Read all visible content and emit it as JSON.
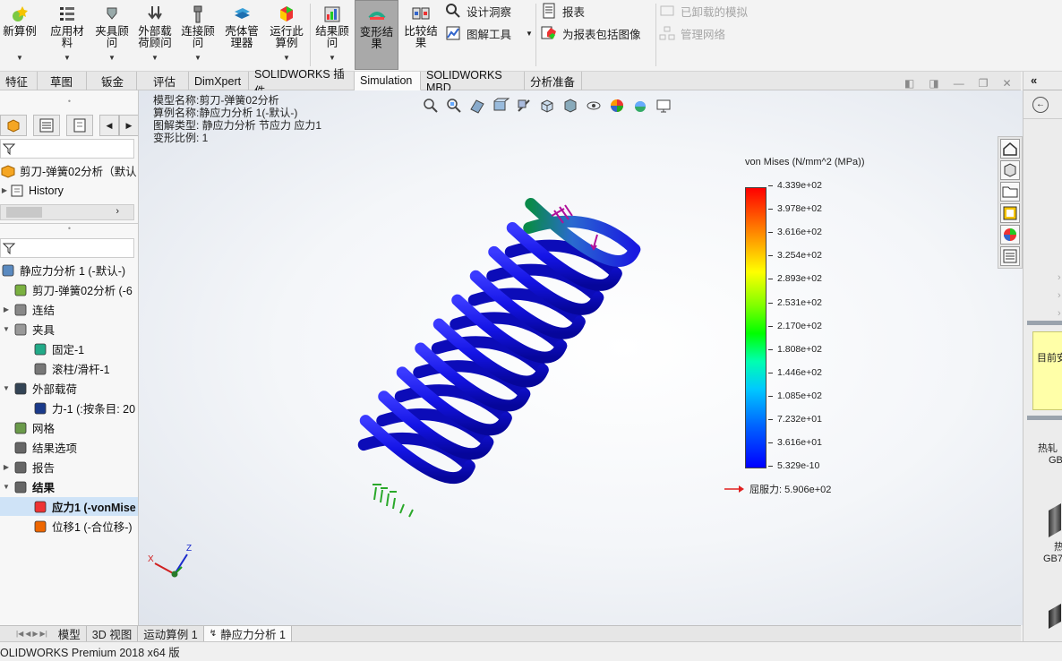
{
  "ribbon": {
    "buttons": [
      {
        "label": "新算例",
        "icon": "new-study-icon"
      },
      {
        "label": "应用材\n料",
        "icon": "apply-material-icon"
      },
      {
        "label": "夹具顾\n问",
        "icon": "fixture-advisor-icon"
      },
      {
        "label": "外部载\n荷顾问",
        "icon": "external-load-advisor-icon"
      },
      {
        "label": "连接顾\n问",
        "icon": "connection-advisor-icon"
      },
      {
        "label": "壳体管\n理器",
        "icon": "shell-manager-icon"
      },
      {
        "label": "运行此\n算例",
        "icon": "run-study-icon"
      },
      {
        "label": "结果顾\n问",
        "icon": "results-advisor-icon"
      },
      {
        "label": "变形结\n果",
        "icon": "deformed-result-icon"
      },
      {
        "label": "比较结\n果",
        "icon": "compare-results-icon"
      }
    ],
    "small": {
      "design_insight": "设计洞察",
      "plot_tools": "图解工具",
      "report": "报表",
      "include_image": "为报表包括图像",
      "unloaded_sims": "已卸载的模拟",
      "manage_network": "管理网络"
    }
  },
  "tabs": [
    "特征",
    "草图",
    "钣金",
    "评估",
    "DimXpert",
    "SOLIDWORKS 插件",
    "Simulation",
    "SOLIDWORKS MBD",
    "分析准备"
  ],
  "active_tab": "Simulation",
  "left": {
    "top_tree": {
      "part": "剪刀-弹簧02分析（默认",
      "history": "History"
    },
    "study_tree": [
      {
        "label": "静应力分析 1 (-默认-)",
        "icon": "static-study-icon",
        "indent": 0
      },
      {
        "label": "剪刀-弹簧02分析 (-6",
        "icon": "part-icon",
        "indent": 1
      },
      {
        "label": "连结",
        "icon": "connections-icon",
        "indent": 1
      },
      {
        "label": "夹具",
        "icon": "fixtures-icon",
        "indent": 1
      },
      {
        "label": "固定-1",
        "icon": "fixed-icon",
        "indent": 2
      },
      {
        "label": "滚柱/滑杆-1",
        "icon": "roller-slider-icon",
        "indent": 2
      },
      {
        "label": "外部载荷",
        "icon": "external-loads-icon",
        "indent": 1
      },
      {
        "label": "力-1 (:按条目: 20",
        "icon": "force-icon",
        "indent": 2
      },
      {
        "label": "网格",
        "icon": "mesh-icon",
        "indent": 1
      },
      {
        "label": "结果选项",
        "icon": "result-options-icon",
        "indent": 1
      },
      {
        "label": "报告",
        "icon": "report-icon",
        "indent": 1
      },
      {
        "label": "结果",
        "icon": "results-icon",
        "indent": 1
      },
      {
        "label": "应力1 (-vonMise",
        "icon": "stress-plot-icon",
        "indent": 2
      },
      {
        "label": "位移1 (-合位移-)",
        "icon": "displacement-plot-icon",
        "indent": 2
      }
    ]
  },
  "viewport": {
    "info": [
      "模型名称:剪刀-弹簧02分析",
      "算例名称:静应力分析 1(-默认-)",
      "图解类型: 静应力分析 节应力 应力1",
      "变形比例: 1"
    ],
    "legend": {
      "title": "von Mises (N/mm^2 (MPa))",
      "ticks": [
        "4.339e+02",
        "3.978e+02",
        "3.616e+02",
        "3.254e+02",
        "2.893e+02",
        "2.531e+02",
        "2.170e+02",
        "1.808e+02",
        "1.446e+02",
        "1.085e+02",
        "7.232e+01",
        "3.616e+01",
        "5.329e-10"
      ],
      "yield_label": "屈服力: 5.906e+02"
    },
    "axes": {
      "x": "X",
      "y": "Y",
      "z": "Z"
    }
  },
  "right_panel": {
    "label1": "目前安",
    "label2": "热轧",
    "label3": "GB",
    "label4": "热",
    "label5": "GB7"
  },
  "bottom_tabs": [
    "模型",
    "3D 视图",
    "运动算例 1",
    "静应力分析 1"
  ],
  "status": "OLIDWORKS Premium 2018 x64 版",
  "colors": {
    "spring": "#1010e0",
    "tab_active": "#fbfbfb",
    "ribbon_active": "#a9a9a9"
  }
}
